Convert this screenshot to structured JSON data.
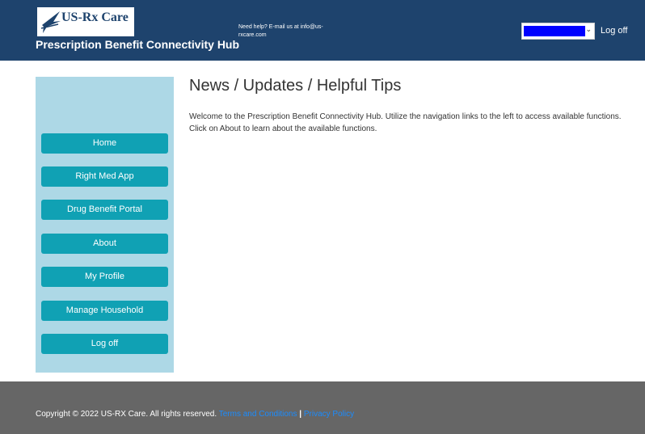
{
  "header": {
    "logo_text": "US-Rx Care",
    "hub_title": "Prescription Benefit Connectivity Hub",
    "help_text": "Need help? E-mail us at info@us-rxcare.com",
    "user_select_icon": "chevron-down-icon",
    "logoff_label": "Log off",
    "colors": {
      "header_bg": "#1e436d",
      "redaction": "#0000ff"
    }
  },
  "sidebar": {
    "items": [
      {
        "label": "Home"
      },
      {
        "label": "Right Med App"
      },
      {
        "label": "Drug Benefit Portal"
      },
      {
        "label": "About"
      },
      {
        "label": "My Profile"
      },
      {
        "label": "Manage Household"
      },
      {
        "label": "Log off"
      }
    ],
    "colors": {
      "panel_bg": "#add8e6",
      "button_bg": "#10a1b4"
    }
  },
  "main": {
    "title": "News / Updates / Helpful Tips",
    "intro": "Welcome to the Prescription Benefit Connectivity Hub. Utilize the navigation links to the left to access available functions. Click on About to learn about the available functions."
  },
  "footer": {
    "copyright": "Copyright © 2022 US-RX Care. All rights reserved.",
    "terms_label": "Terms and Conditions",
    "separator": "|",
    "privacy_label": "Privacy Policy",
    "colors": {
      "footer_bg": "#666666",
      "link": "#1a8cff"
    }
  }
}
